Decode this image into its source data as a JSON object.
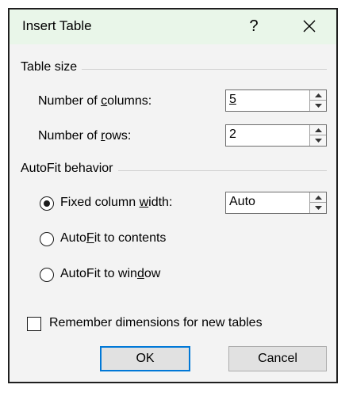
{
  "dialog": {
    "title": "Insert Table",
    "help_label": "?",
    "table_size": {
      "group_label": "Table size",
      "columns_label_pre": "Number of ",
      "columns_label_accel": "c",
      "columns_label_post": "olumns:",
      "columns_value": "5",
      "rows_label_pre": "Number of ",
      "rows_label_accel": "r",
      "rows_label_post": "ows:",
      "rows_value": "2"
    },
    "autofit": {
      "group_label": "AutoFit behavior",
      "fixed_label_pre": "Fixed column ",
      "fixed_label_accel": "w",
      "fixed_label_post": "idth:",
      "fixed_value": "Auto",
      "contents_label_pre": "Auto",
      "contents_label_accel": "F",
      "contents_label_post": "it to contents",
      "window_label_pre": "AutoFit to win",
      "window_label_accel": "d",
      "window_label_post": "ow",
      "selected": "fixed"
    },
    "remember_label_pre": "Remember dimensions for new tables",
    "remember_checked": false,
    "ok_label": "OK",
    "cancel_label": "Cancel"
  }
}
